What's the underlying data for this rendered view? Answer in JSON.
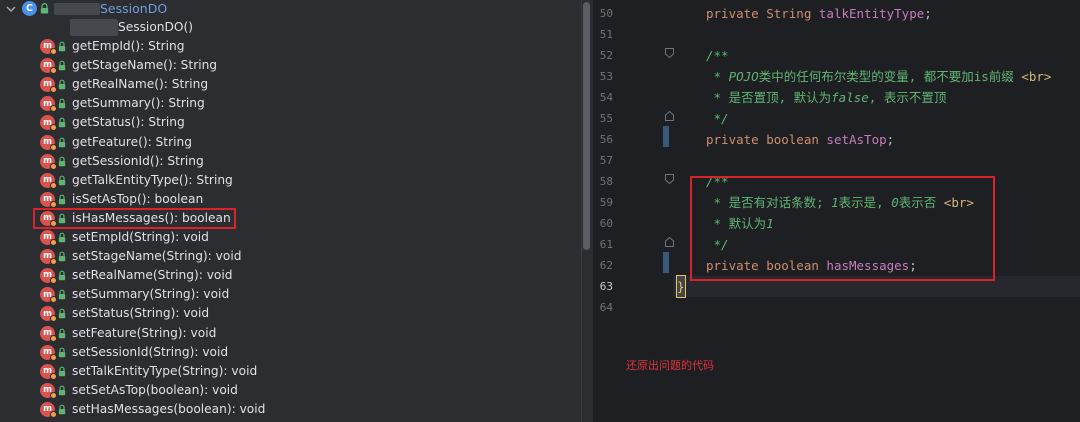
{
  "structure": {
    "class_icon": "C",
    "class_name": "SessionDO",
    "constructor": "SessionDO()",
    "methods": [
      "getEmpId(): String",
      "getStageName(): String",
      "getRealName(): String",
      "getSummary(): String",
      "getStatus(): String",
      "getFeature(): String",
      "getSessionId(): String",
      "getTalkEntityType(): String",
      "isSetAsTop(): boolean",
      "isHasMessages(): boolean",
      "setEmpId(String): void",
      "setStageName(String): void",
      "setRealName(String): void",
      "setSummary(String): void",
      "setStatus(String): void",
      "setFeature(String): void",
      "setSessionId(String): void",
      "setTalkEntityType(String): void",
      "setSetAsTop(boolean): void",
      "setHasMessages(boolean): void"
    ],
    "method_badge": "m"
  },
  "editor": {
    "line_numbers": [
      "50",
      "51",
      "52",
      "53",
      "54",
      "55",
      "56",
      "57",
      "58",
      "59",
      "60",
      "61",
      "62",
      "63",
      "64"
    ],
    "current_line": "63",
    "lines": {
      "l50": {
        "kw": "private String ",
        "field": "talkEntityType",
        "end": ";"
      },
      "l52": "/**",
      "l53": {
        "star": " * ",
        "pojo": "POJO",
        "text": "类中的任何布尔类型的变量, 都不要加is前缀 ",
        "tag": "<br>"
      },
      "l54": {
        "star": " * ",
        "text": "是否置顶, 默认为",
        "false": "false",
        "rest": ", 表示不置顶"
      },
      "l55": " */",
      "l56": {
        "kw": "private boolean ",
        "field": "setAsTop",
        "end": ";"
      },
      "l58": "/**",
      "l59": {
        "star": " * ",
        "text": "是否有对话条数; ",
        "one": "1",
        "mid": "表示是, ",
        "zero": "0",
        "rest": "表示否 ",
        "tag": "<br>"
      },
      "l60": {
        "star": " * ",
        "text": "默认为",
        "one": "1"
      },
      "l61": " */",
      "l62": {
        "kw": "private boolean ",
        "field": "hasMessages",
        "end": ";"
      },
      "l63": "}"
    }
  },
  "annotation": "还原出问题的代码",
  "colors": {
    "highlight_border": "#d8232a",
    "method_icon": "#d9534f",
    "class_icon": "#4a8fe8",
    "doc_comment": "#5fb474",
    "keyword": "#cf8e6d",
    "field": "#c77dbb"
  }
}
